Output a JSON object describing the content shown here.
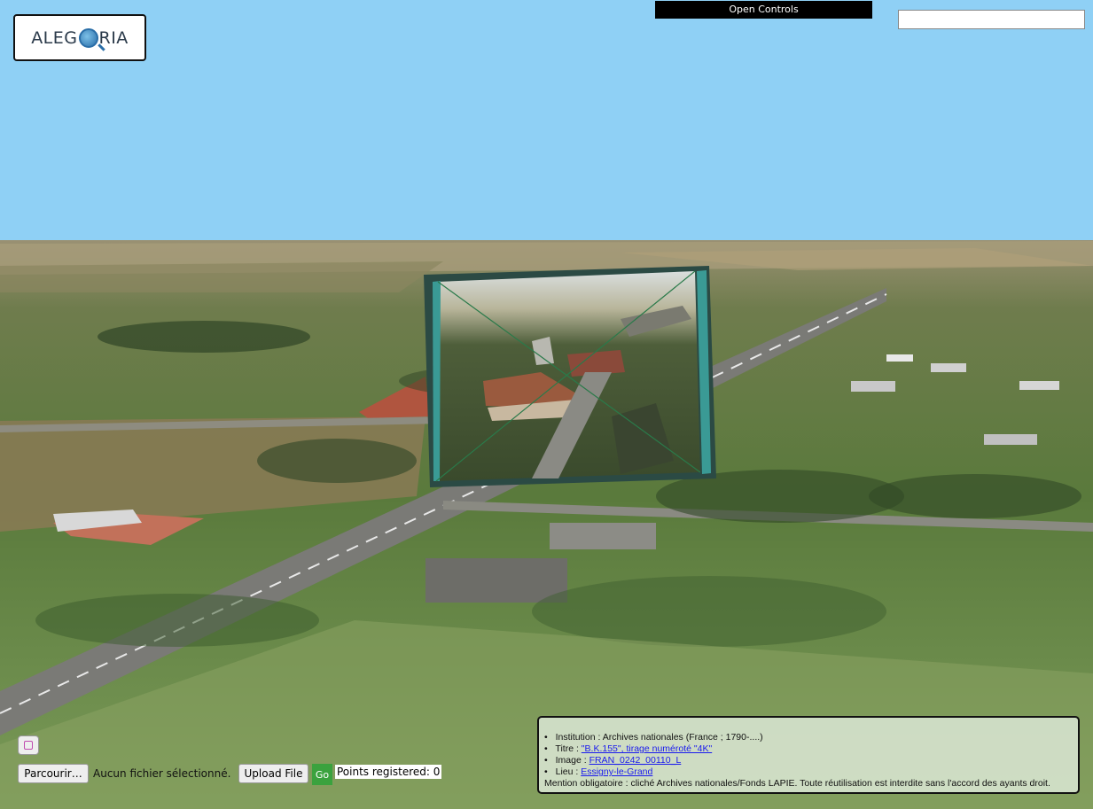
{
  "logo": {
    "text_left": "ALEG",
    "text_right": "RIA"
  },
  "controls": {
    "open_controls_label": "Open Controls",
    "search_value": ""
  },
  "upload": {
    "browse_label": "Parcourir…",
    "no_file_label": "Aucun fichier sélectionné.",
    "upload_label": "Upload File",
    "go_label": "Go",
    "points_registered": "Points registered: 0"
  },
  "info": {
    "institution_label": "Institution :",
    "institution_value": "Archives nationales (France ; 1790-....)",
    "titre_label": "Titre :",
    "titre_value": "\"B.K.155\", tirage numéroté \"4K\"",
    "image_label": "Image :",
    "image_value": "FRAN_0242_00110_L",
    "lieu_label": "Lieu :",
    "lieu_value": "Essigny-le-Grand",
    "mention": "Mention obligatoire : cliché Archives nationales/Fonds LAPIE. Toute réutilisation est interdite sans l'accord des ayants droit."
  },
  "colors": {
    "sky": "#8fd0f5",
    "go_green": "#3aa23e",
    "photo_frame": "#2b4a44"
  }
}
